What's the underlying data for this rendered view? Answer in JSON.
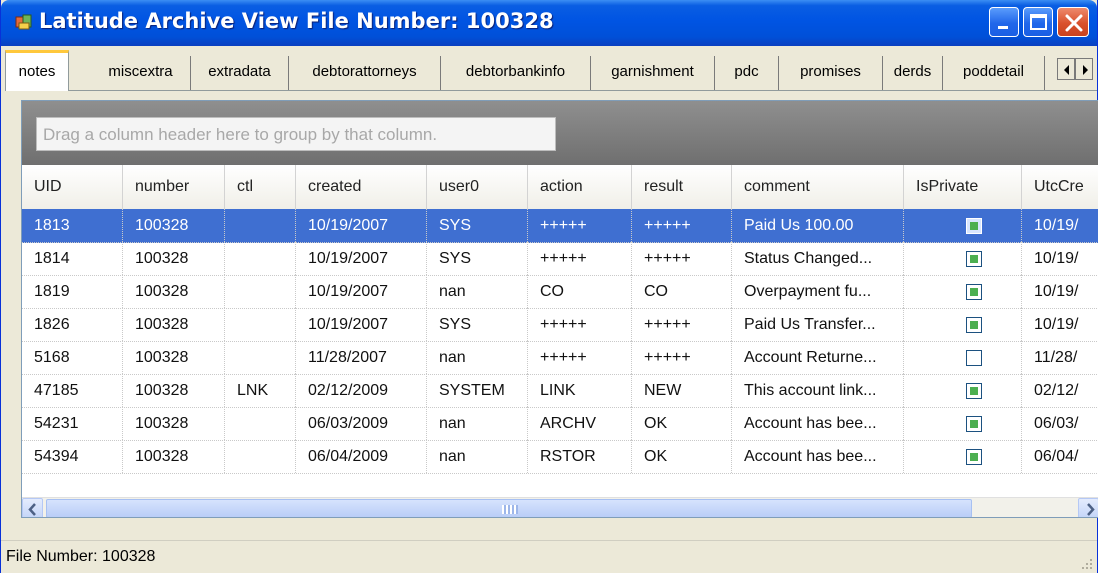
{
  "window": {
    "title": "Latitude Archive View File Number: 100328",
    "title_color": "#ffffff",
    "titlebar_color": "#0054e3"
  },
  "tabs": [
    {
      "label": "notes",
      "active": true
    },
    {
      "label": "miscextra",
      "active": false
    },
    {
      "label": "extradata",
      "active": false
    },
    {
      "label": "debtorattorneys",
      "active": false
    },
    {
      "label": "debtorbankinfo",
      "active": false
    },
    {
      "label": "garnishment",
      "active": false
    },
    {
      "label": "pdc",
      "active": false
    },
    {
      "label": "promises",
      "active": false
    },
    {
      "label": "derds",
      "active": false
    },
    {
      "label": "poddetail",
      "active": false
    }
  ],
  "tab_scroll": {
    "left_icon": "arrow-left-icon",
    "right_icon": "arrow-right-icon"
  },
  "grid": {
    "group_panel_text": "Drag a column header here to group by that column.",
    "columns": [
      "UID",
      "number",
      "ctl",
      "created",
      "user0",
      "action",
      "result",
      "comment",
      "IsPrivate",
      "UtcCre"
    ],
    "rows": [
      {
        "uid": "1813",
        "number": "100328",
        "ctl": "",
        "created": "10/19/2007",
        "user0": "SYS",
        "action": "+++++",
        "result": "+++++",
        "comment": "Paid Us 100.00",
        "is_private": true,
        "utc": "10/19/",
        "selected": true
      },
      {
        "uid": "1814",
        "number": "100328",
        "ctl": "",
        "created": "10/19/2007",
        "user0": "SYS",
        "action": "+++++",
        "result": "+++++",
        "comment": "Status Changed...",
        "is_private": true,
        "utc": "10/19/",
        "selected": false
      },
      {
        "uid": "1819",
        "number": "100328",
        "ctl": "",
        "created": "10/19/2007",
        "user0": "nan",
        "action": "CO",
        "result": "CO",
        "comment": "Overpayment fu...",
        "is_private": true,
        "utc": "10/19/",
        "selected": false
      },
      {
        "uid": "1826",
        "number": "100328",
        "ctl": "",
        "created": "10/19/2007",
        "user0": "SYS",
        "action": "+++++",
        "result": "+++++",
        "comment": "Paid Us Transfer...",
        "is_private": true,
        "utc": "10/19/",
        "selected": false
      },
      {
        "uid": "5168",
        "number": "100328",
        "ctl": "",
        "created": "11/28/2007",
        "user0": "nan",
        "action": "+++++",
        "result": "+++++",
        "comment": "Account Returne...",
        "is_private": false,
        "utc": "11/28/",
        "selected": false
      },
      {
        "uid": "47185",
        "number": "100328",
        "ctl": "LNK",
        "created": "02/12/2009",
        "user0": "SYSTEM",
        "action": "LINK",
        "result": "NEW",
        "comment": "This account link...",
        "is_private": true,
        "utc": "02/12/",
        "selected": false
      },
      {
        "uid": "54231",
        "number": "100328",
        "ctl": "",
        "created": "06/03/2009",
        "user0": "nan",
        "action": "ARCHV",
        "result": "OK",
        "comment": "Account has bee...",
        "is_private": true,
        "utc": "06/03/",
        "selected": false
      },
      {
        "uid": "54394",
        "number": "100328",
        "ctl": "",
        "created": "06/04/2009",
        "user0": "nan",
        "action": "RSTOR",
        "result": "OK",
        "comment": "Account has bee...",
        "is_private": true,
        "utc": "06/04/",
        "selected": false
      }
    ],
    "selected_row_color": "#3f6fd1",
    "checkbox_checked_color": "#4caf50"
  },
  "status_bar": {
    "text": "File Number: 100328"
  }
}
